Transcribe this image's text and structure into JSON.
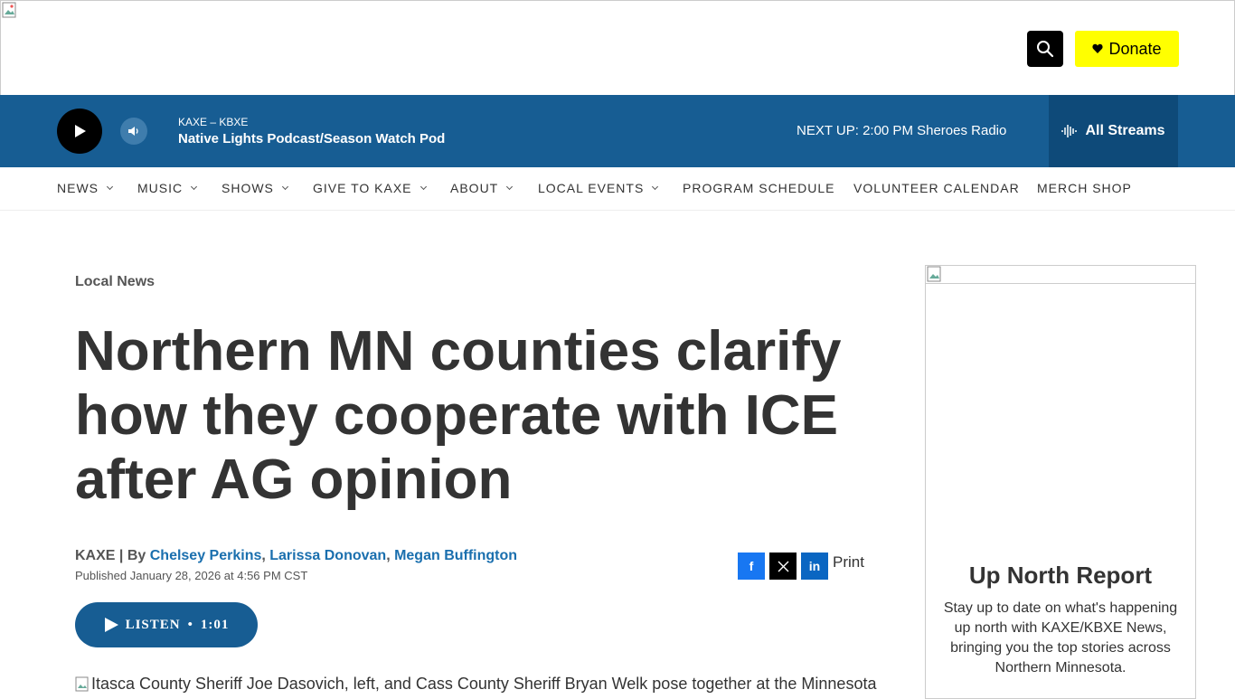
{
  "header": {
    "donate_label": "Donate"
  },
  "player": {
    "station": "KAXE – KBXE",
    "program": "Native Lights Podcast/Season Watch Pod",
    "next_up": "NEXT UP: 2:00 PM Sheroes Radio",
    "streams_label": "All Streams"
  },
  "nav": {
    "items": [
      {
        "label": "NEWS",
        "dropdown": true
      },
      {
        "label": "MUSIC",
        "dropdown": true
      },
      {
        "label": "SHOWS",
        "dropdown": true
      },
      {
        "label": "GIVE TO KAXE",
        "dropdown": true
      },
      {
        "label": "ABOUT",
        "dropdown": true
      },
      {
        "label": "LOCAL EVENTS",
        "dropdown": true
      },
      {
        "label": "PROGRAM SCHEDULE",
        "dropdown": false
      },
      {
        "label": "VOLUNTEER CALENDAR",
        "dropdown": false
      },
      {
        "label": "MERCH SHOP",
        "dropdown": false
      }
    ]
  },
  "article": {
    "section": "Local News",
    "title": "Northern MN counties clarify how they cooperate with ICE after AG opinion",
    "source": "KAXE",
    "by_label": "| By",
    "authors": [
      "Chelsey Perkins",
      "Larissa Donovan",
      "Megan Buffington"
    ],
    "published": "Published January 28, 2026 at 4:56 PM CST",
    "listen_label": "LISTEN",
    "listen_sep": "•",
    "listen_duration": "1:01",
    "image_alt": "Itasca County Sheriff Joe Dasovich, left, and Cass County Sheriff Bryan Welk pose together at the Minnesota"
  },
  "share": {
    "facebook": "f",
    "linkedin": "in",
    "print_label": "Print"
  },
  "sidebar": {
    "title": "Up North Report",
    "text": "Stay up to date on what's happening up north with KAXE/KBXE News, bringing you the top stories across Northern Minnesota."
  },
  "colors": {
    "player_bg": "#175d93",
    "streams_bg": "#0e4a79",
    "donate_bg": "#ffff00",
    "link": "#1a6fae",
    "facebook": "#1877f2",
    "x": "#000000",
    "linkedin": "#0a66c2"
  }
}
